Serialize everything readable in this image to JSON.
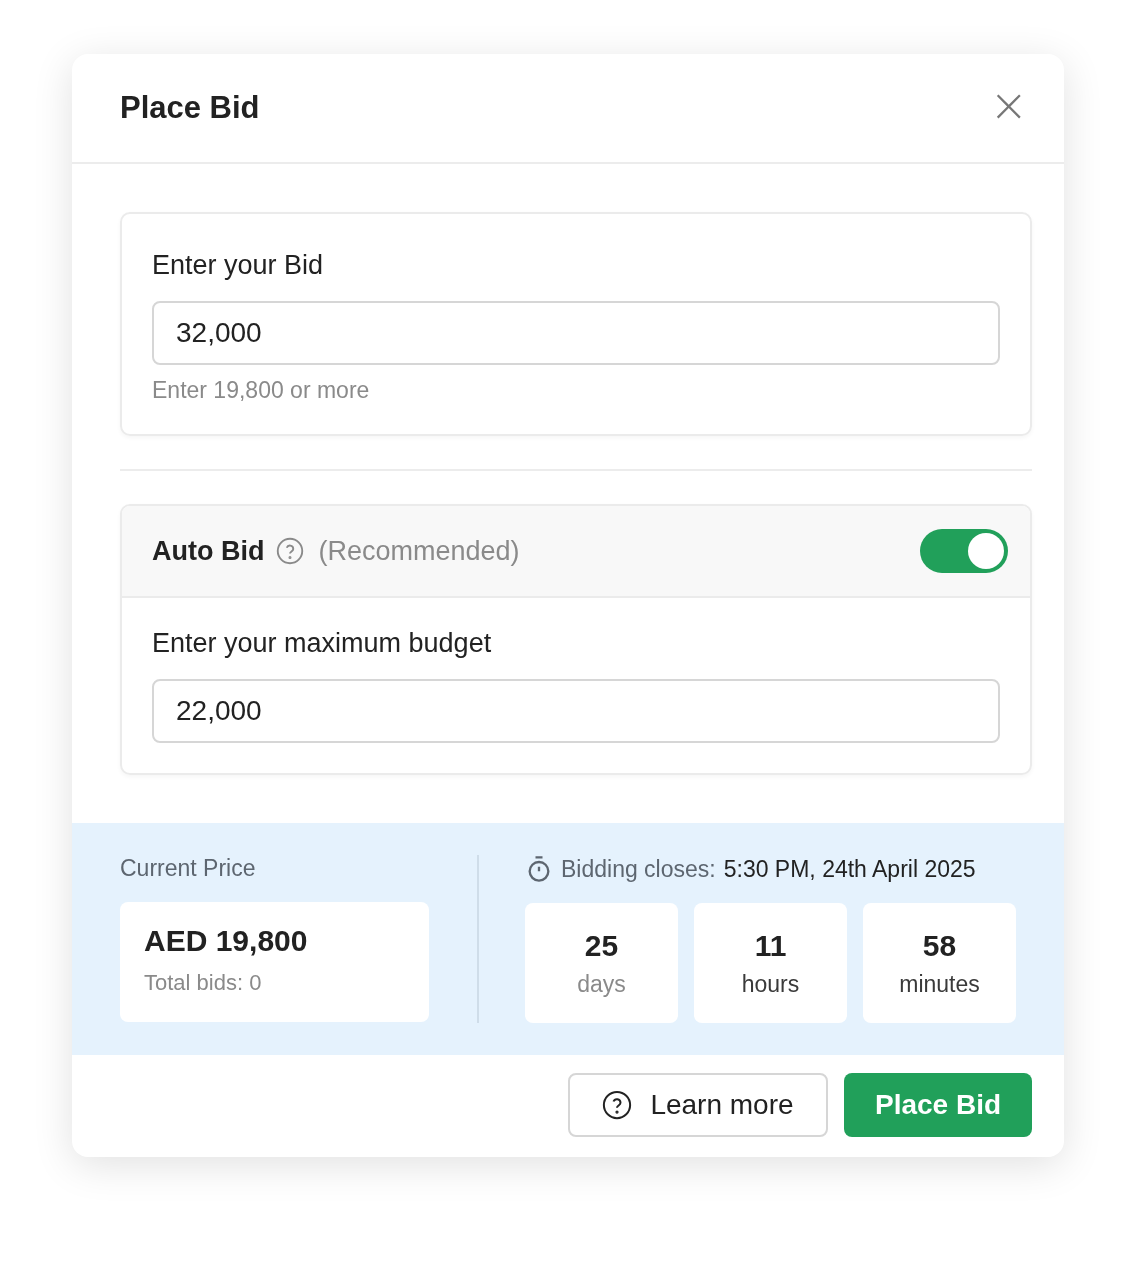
{
  "dialog": {
    "title": "Place Bid",
    "close": "×"
  },
  "bid": {
    "label": "Enter your Bid",
    "value": "32,000",
    "hint": "Enter 19,800 or more"
  },
  "auto_bid": {
    "label": "Auto Bid",
    "note": "(Recommended)",
    "on": true,
    "budget_label": "Enter your maximum budget",
    "budget_value": "22,000"
  },
  "price": {
    "label": "Current Price",
    "amount": "AED 19,800",
    "total_bids": "Total bids: 0"
  },
  "closing": {
    "label": "Bidding closes:",
    "time": "5:30 PM, 24th April 2025",
    "countdown": [
      {
        "value": "25",
        "unit": "days",
        "dimmed": true
      },
      {
        "value": "11",
        "unit": "hours",
        "dimmed": false
      },
      {
        "value": "58",
        "unit": "minutes",
        "dimmed": false
      }
    ]
  },
  "buttons": {
    "learn_more": "Learn more",
    "place_bid": "Place Bid"
  }
}
